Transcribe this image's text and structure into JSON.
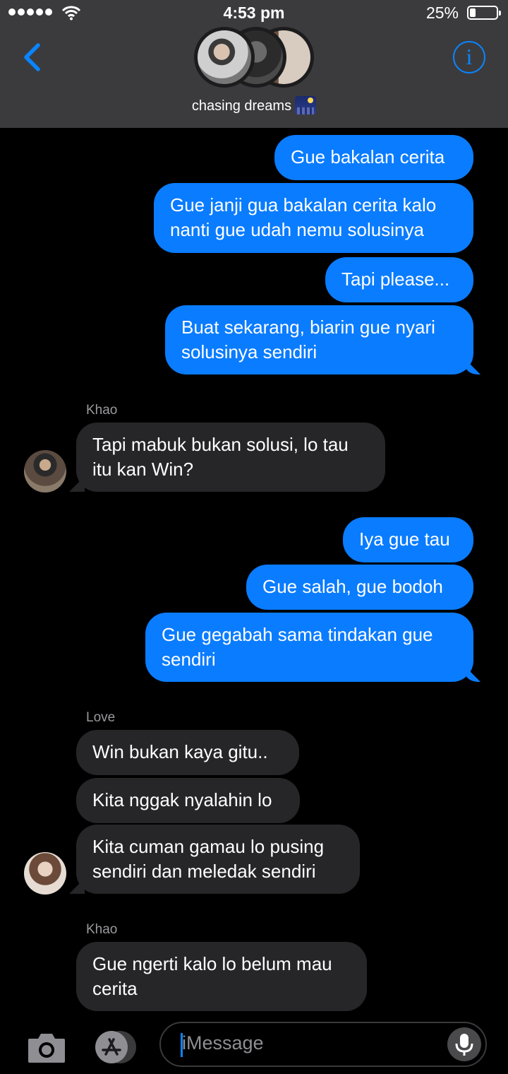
{
  "status_bar": {
    "time": "4:53 pm",
    "battery_percent": "25%",
    "battery_level": 0.25
  },
  "header": {
    "group_name": "chasing dreams",
    "group_emoji": "night-stars-emoji"
  },
  "messages": [
    {
      "type": "outgoing",
      "text": "Gue bakalan cerita"
    },
    {
      "type": "outgoing",
      "text": "Gue janji gua bakalan cerita kalo\nnanti gue udah nemu solusinya"
    },
    {
      "type": "outgoing",
      "text": "Tapi please..."
    },
    {
      "type": "outgoing",
      "text": "Buat sekarang, biarin gue nyari\nsolusinya sendiri"
    },
    {
      "type": "sender_label",
      "text": "Khao"
    },
    {
      "type": "incoming",
      "sender": "Khao",
      "text": "Tapi mabuk bukan solusi, lo tau\nitu kan Win?"
    },
    {
      "type": "outgoing",
      "text": "Iya gue tau"
    },
    {
      "type": "outgoing",
      "text": "Gue salah, gue bodoh"
    },
    {
      "type": "outgoing",
      "text": "Gue gegabah sama tindakan gue\nsendiri"
    },
    {
      "type": "sender_label",
      "text": "Love"
    },
    {
      "type": "incoming",
      "sender": "Love",
      "text": "Win bukan kaya gitu.."
    },
    {
      "type": "incoming",
      "sender": "Love",
      "text": "Kita nggak nyalahin lo"
    },
    {
      "type": "incoming",
      "sender": "Love",
      "text": "Kita cuman gamau lo pusing\nsendiri dan meledak sendiri"
    },
    {
      "type": "sender_label",
      "text": "Khao"
    },
    {
      "type": "incoming",
      "sender": "Khao",
      "text": "Gue ngerti kalo lo belum mau\ncerita"
    }
  ],
  "input_bar": {
    "placeholder": "iMessage"
  },
  "colors": {
    "outgoing_bubble": "#0a7cff",
    "incoming_bubble": "#262628",
    "accent": "#0a84ff",
    "header_bg": "#3b3b3d"
  },
  "icons": [
    "back-chevron-icon",
    "info-icon",
    "camera-icon",
    "app-store-icon",
    "microphone-icon",
    "wifi-icon",
    "battery-icon"
  ]
}
